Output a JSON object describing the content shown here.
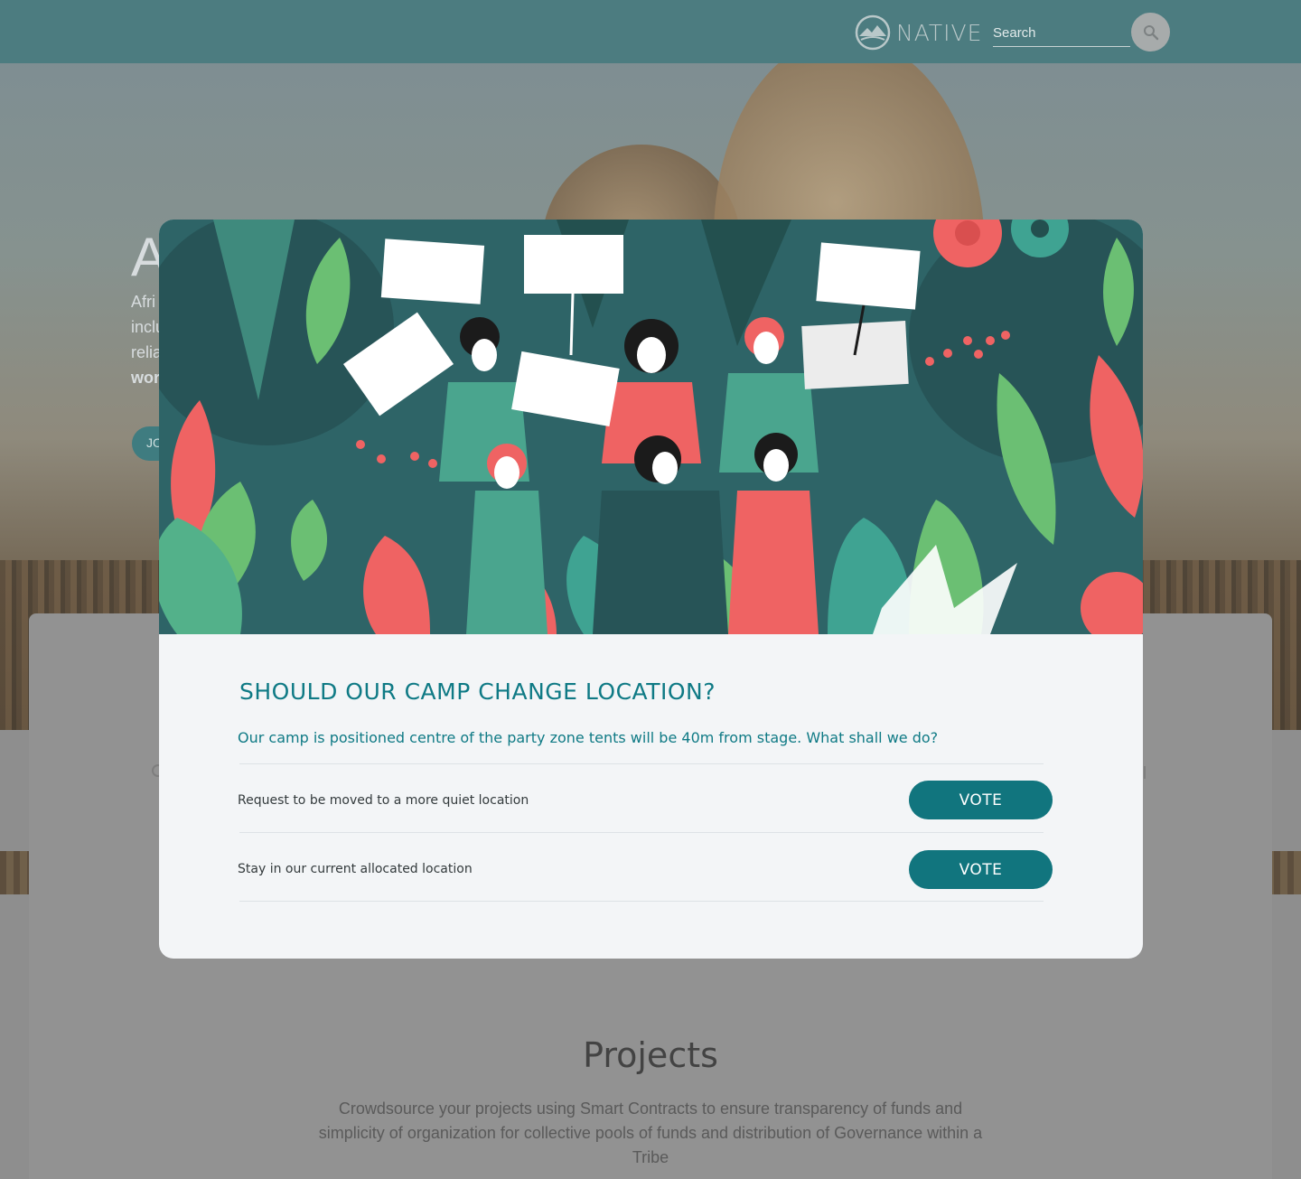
{
  "header": {
    "logo_text": "NATIVE",
    "search_placeholder": "Search"
  },
  "hero": {
    "heading": "A",
    "lines": [
      "Afri",
      "inclu",
      "relia"
    ],
    "bold_line": "wor",
    "join_label": "JO"
  },
  "projects": {
    "title": "Projects",
    "description": "Crowdsource your projects using Smart Contracts to ensure transparency of funds and simplicity of organization for collective pools of funds and distribution of Governance within a Tribe"
  },
  "modal": {
    "title": "SHOULD OUR CAMP CHANGE LOCATION?",
    "question": "Our camp is positioned centre of the party zone tents will be 40m from stage.  What shall we do?",
    "options": [
      {
        "label": "Request to be moved to a more quiet location",
        "button": "VOTE"
      },
      {
        "label": "Stay in our current allocated location",
        "button": "VOTE"
      }
    ]
  },
  "colors": {
    "accent": "#11757e",
    "illustration_bg": "#2e6467",
    "coral": "#ef6363",
    "leaf_green": "#6bbf73",
    "teal_light": "#4aa58e"
  },
  "icons": {
    "search": "search-icon",
    "logo": "native-logo-icon"
  }
}
